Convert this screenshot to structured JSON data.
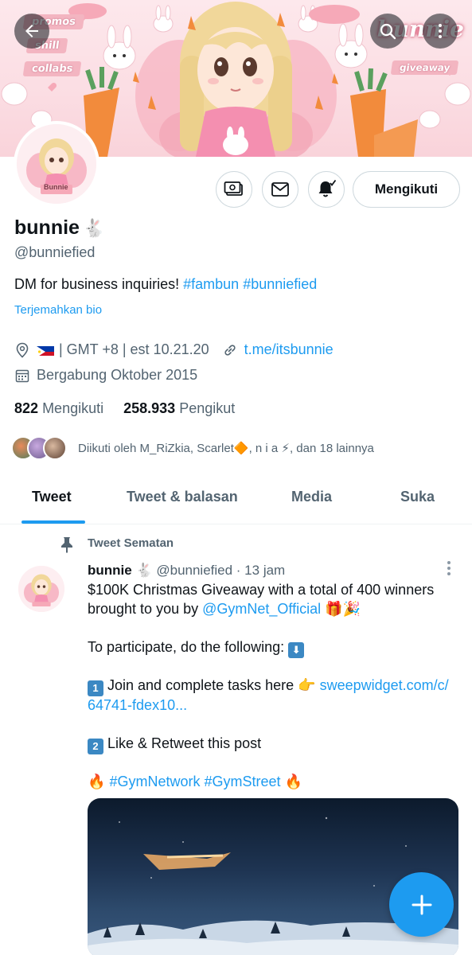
{
  "banner": {
    "tags": [
      "promos",
      "shill",
      "collabs"
    ],
    "giveaway_tag": "giveaway",
    "word": "bunnie",
    "colors": {
      "pink": "#f3b5c1",
      "carrot": "#f28b3c"
    }
  },
  "avatar": {
    "label": "Bunnie"
  },
  "actions": {
    "follow_label": "Mengikuti"
  },
  "profile": {
    "display_name": "bunnie",
    "name_emoji": "🐇",
    "handle": "@bunniefied",
    "bio_text": "DM for business inquiries!",
    "bio_tag1": "#fambun",
    "bio_tag2": "#bunniefied",
    "translate": "Terjemahkan bio",
    "location": "| GMT +8 | est 10.21.20",
    "website": "t.me/itsbunnie",
    "joined": "Bergabung Oktober 2015",
    "following_count": "822",
    "following_label": "Mengikuti",
    "followers_count": "258.933",
    "followers_label": "Pengikut",
    "followed_by": "Diikuti oleh M_RiZkia, Scarlet🔶, n i a ⚡, dan 18 lainnya"
  },
  "tabs": [
    "Tweet",
    "Tweet & balasan",
    "Media",
    "Suka"
  ],
  "tweet": {
    "pinned_label": "Tweet Sematan",
    "name": "bunnie",
    "name_emoji": "🐇",
    "meta": "@bunniefied · 13 jam",
    "line1": "$100K Christmas Giveaway with a total of 400 winners",
    "line2_text": "brought to you by",
    "line2_link": "@GymNet_Official",
    "line2_emoji": "🎁🎉",
    "line3": "To participate, do the following:",
    "line3_key": "⬇",
    "line4_key": "1",
    "line4_text": "Join and complete tasks here 👉",
    "line4_link": "sweepwidget.com/c/",
    "line5_link": "64741-fdex10...",
    "line6_key": "2",
    "line6_text": "Like & Retweet this post",
    "line7_fire1": "🔥",
    "line7_tags": "#GymNetwork #GymStreet",
    "line7_fire2": "🔥"
  },
  "colors": {
    "accent": "#1d9bf0",
    "text": "#0f1419",
    "muted": "#536471"
  }
}
